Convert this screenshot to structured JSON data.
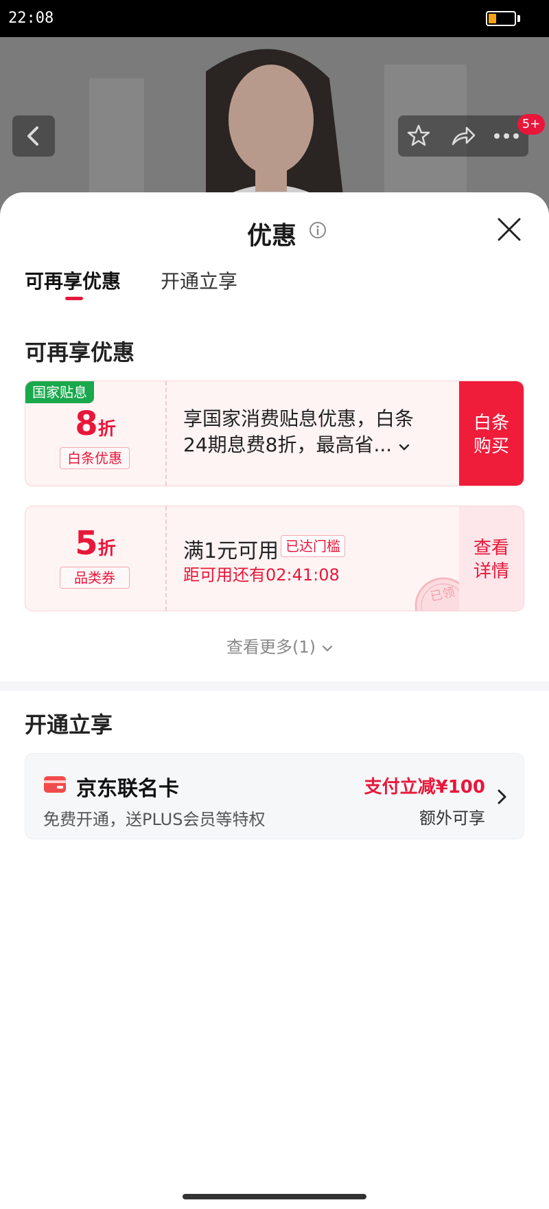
{
  "status_bar": {
    "time": "22:08",
    "battery_level": 0.3,
    "battery_color": "#f7a11a"
  },
  "header": {
    "notification_badge": "5+"
  },
  "sheet": {
    "title": "优惠",
    "tabs": [
      {
        "label": "可再享优惠",
        "active": true
      },
      {
        "label": "开通立享",
        "active": false
      }
    ],
    "section_available": {
      "title": "可再享优惠",
      "coupons": [
        {
          "ribbon": "国家贴息",
          "discount_number": "8",
          "discount_unit": "折",
          "label": "白条优惠",
          "description": "享国家消费贴息优惠，白条24期息费8折，最高省...",
          "cta": [
            "白条",
            "购买"
          ]
        },
        {
          "discount_number": "5",
          "discount_unit": "折",
          "label": "品类券",
          "threshold": "满1元可用",
          "threshold_tag": "已达门槛",
          "countdown": "距可用还有02:41:08",
          "stamp": "已领",
          "cta": [
            "查看",
            "详情"
          ]
        }
      ],
      "see_more": "查看更多(1)"
    },
    "section_activate": {
      "title": "开通立享",
      "card": {
        "name": "京东联名卡",
        "subtitle": "免费开通，送PLUS会员等特权",
        "discount": "支付立减¥100",
        "extra": "额外可享"
      }
    }
  },
  "colors": {
    "accent": "#e8173a",
    "ribbon_green": "#19a84c"
  }
}
